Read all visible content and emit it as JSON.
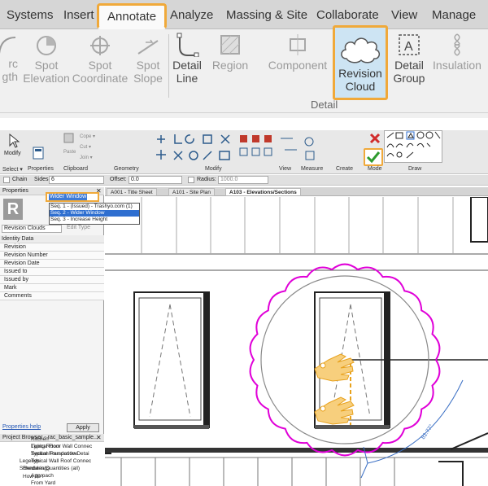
{
  "top_ribbon": {
    "tabs": [
      "Systems",
      "Insert",
      "Annotate",
      "Analyze",
      "Massing & Site",
      "Collaborate",
      "View",
      "Manage"
    ],
    "active_tab": "Annotate",
    "buttons": [
      {
        "l1": "rc",
        "l2": "gth"
      },
      {
        "l1": "Spot",
        "l2": "Elevation"
      },
      {
        "l1": "Spot",
        "l2": "Coordinate"
      },
      {
        "l1": "Spot",
        "l2": "Slope"
      },
      {
        "l1": "Detail",
        "l2": "Line"
      },
      {
        "l1": "Region",
        "l2": ""
      },
      {
        "l1": "Component",
        "l2": ""
      },
      {
        "l1": "Detail",
        "l2": "Group"
      },
      {
        "l1": "Insulation",
        "l2": ""
      }
    ],
    "revision_cloud": {
      "l1": "Revision",
      "l2": "Cloud"
    },
    "panel_label": "Detail"
  },
  "main_ribbon": {
    "groups": [
      "Select ▾",
      "Properties",
      "Clipboard",
      "Geometry",
      "Modify",
      "View",
      "Measure",
      "Create",
      "Mode",
      "Draw"
    ],
    "modify_label": "Modify",
    "properties_label": "Properties",
    "clipboard": [
      "Cope ▾",
      "Cut ▾",
      "Join ▾",
      "Paste"
    ]
  },
  "options_bar": {
    "chain_label": "Chain",
    "sides_label": "Sides:",
    "sides_value": "6",
    "offset_label": "Offset:",
    "offset_value": "0.0",
    "radius_label": "Radius:",
    "radius_value": "1000.0"
  },
  "properties": {
    "header": "Properties",
    "type_dropdown": "Revision Clouds",
    "edit_type": "Edit Type",
    "section": "Identity Data",
    "rows": [
      "Revision",
      "Revision Number",
      "Revision Date",
      "Issued to",
      "Issued by",
      "Mark",
      "Comments"
    ],
    "revision_value": "Wider Window",
    "dropdown_options": [
      "Seq. 1 - (Issued) - Trashyo.com (1)",
      "Seq. 2 - Wider Window",
      "Seq. 3 - Increase Height"
    ],
    "help_link": "Properties help",
    "apply": "Apply"
  },
  "project_browser": {
    "title": "Project Browser - rac_basic_sample...",
    "items": [
      "Typical Floor Wall Connec",
      "Typical Foundation Detai",
      "Typical Wall Roof Connec",
      "Renderings",
      "Approach",
      "From Yard",
      "Kitchen",
      "Living Room",
      "Section Perspective",
      "Legends",
      "Schedules/Quantities (all)",
      "How do I"
    ]
  },
  "view_tabs": [
    "A001 - Title Sheet",
    "A101 - Site Plan",
    "A103 - Elevations/Sections"
  ],
  "active_view": "A103 - Elevations/Sections",
  "dimension_text": "81.77°",
  "colors": {
    "highlight": "#f0a93a",
    "cloud": "#e000d8",
    "selection": "#2f6fd0"
  }
}
